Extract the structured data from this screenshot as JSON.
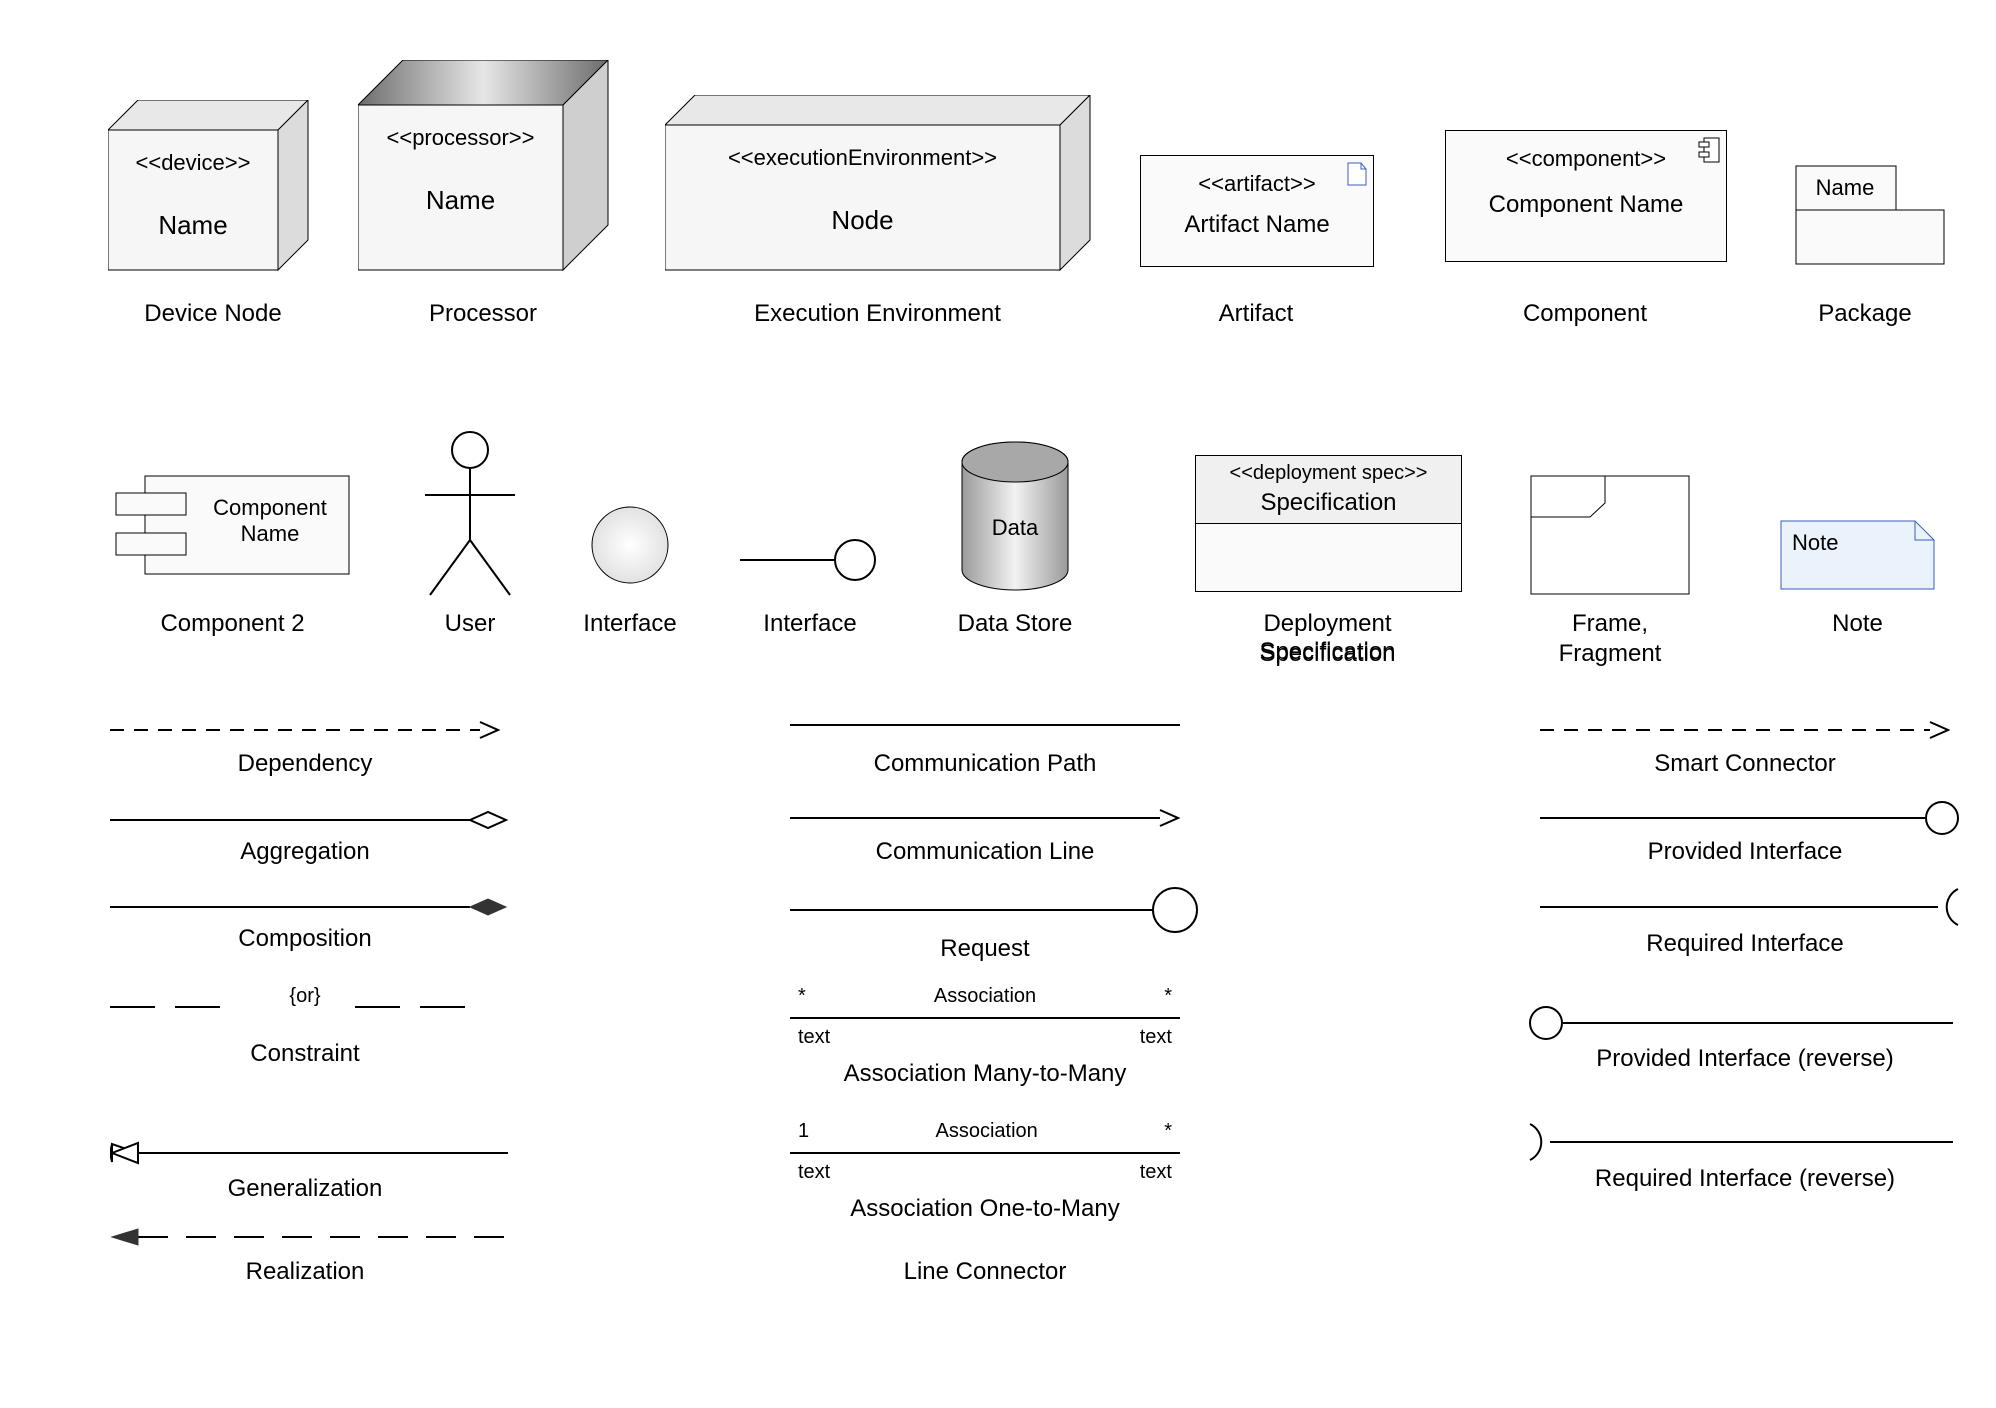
{
  "row1": {
    "deviceNode": {
      "stereo": "<<device>>",
      "name": "Name",
      "caption": "Device Node"
    },
    "processor": {
      "stereo": "<<processor>>",
      "name": "Name",
      "caption": "Processor"
    },
    "execEnv": {
      "stereo": "<<executionEnvironment>>",
      "name": "Node",
      "caption": "Execution Environment"
    },
    "artifact": {
      "stereo": "<<artifact>>",
      "name": "Artifact Name",
      "caption": "Artifact"
    },
    "component": {
      "stereo": "<<component>>",
      "name": "Component Name",
      "caption": "Component"
    },
    "package": {
      "name": "Name",
      "caption": "Package"
    }
  },
  "row2": {
    "component2": {
      "name": "Component Name",
      "caption": "Component 2"
    },
    "user": {
      "caption": "User"
    },
    "interface1": {
      "caption": "Interface"
    },
    "interface2": {
      "caption": "Interface"
    },
    "dataStore": {
      "name": "Data",
      "caption": "Data Store"
    },
    "deploySpec": {
      "stereo": "<<deployment spec>>",
      "name": "Specification",
      "caption": "Deployment Specification"
    },
    "frame": {
      "captionA": "Frame,",
      "captionB": "Fragment"
    },
    "note": {
      "name": "Note",
      "caption": "Note"
    }
  },
  "connectors": {
    "col1": {
      "dependency": "Dependency",
      "aggregation": "Aggregation",
      "composition": "Composition",
      "constraint": {
        "text": "{or}",
        "caption": "Constraint"
      },
      "generalization": "Generalization",
      "realization": "Realization"
    },
    "col2": {
      "commPath": "Communication Path",
      "commLine": "Communication Line",
      "request": "Request",
      "assocMM": {
        "star": "*",
        "word": "Association",
        "text": "text",
        "caption": "Association Many-to-Many"
      },
      "assocOM": {
        "one": "1",
        "star": "*",
        "word": "Association",
        "text": "text",
        "caption": "Association One-to-Many"
      },
      "lineConnector": "Line Connector"
    },
    "col3": {
      "smart": "Smart Connector",
      "provided": "Provided Interface",
      "required": "Required Interface",
      "providedRev": "Provided Interface (reverse)",
      "requiredRev": "Required Interface (reverse)"
    }
  }
}
